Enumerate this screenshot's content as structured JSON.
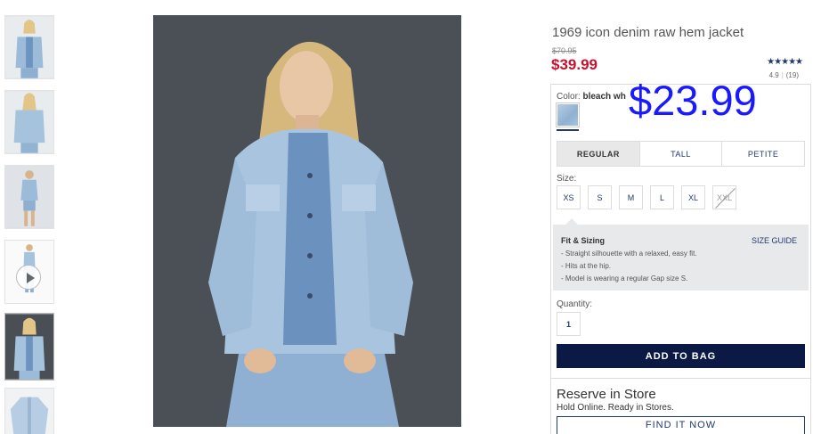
{
  "product": {
    "title": "1969 icon denim raw hem jacket",
    "original_price": "$70.95",
    "sale_price": "$39.99",
    "overlay_price": "$23.99",
    "stars": "★★★★★",
    "rating": "4.9",
    "review_count": "(19)"
  },
  "color": {
    "label": "Color:",
    "selected": "bleach wh",
    "swatch_color": "#a8c3de"
  },
  "fit_tabs": [
    {
      "label": "REGULAR",
      "active": true
    },
    {
      "label": "TALL",
      "active": false
    },
    {
      "label": "PETITE",
      "active": false
    }
  ],
  "size": {
    "label": "Size:",
    "options": [
      "XS",
      "S",
      "M",
      "L",
      "XL",
      "XXL"
    ],
    "unavailable": [
      "XXL"
    ]
  },
  "fit_sizing": {
    "title": "Fit & Sizing",
    "size_guide": "SIZE GUIDE",
    "bullets": [
      "- Straight silhouette with a relaxed, easy fit.",
      "- Hits at the hip.",
      "- Model is wearing a regular Gap size S."
    ]
  },
  "quantity": {
    "label": "Quantity:",
    "value": "1"
  },
  "actions": {
    "add_to_bag": "ADD TO BAG",
    "find_it_now": "FIND IT NOW"
  },
  "reserve": {
    "title": "Reserve in Store",
    "subtitle": "Hold Online. Ready in Stores."
  },
  "colors": {
    "sale_red": "#c8102e",
    "navy": "#0a1a45",
    "link_blue": "#203a70",
    "overlay_blue": "#1a1aff"
  }
}
